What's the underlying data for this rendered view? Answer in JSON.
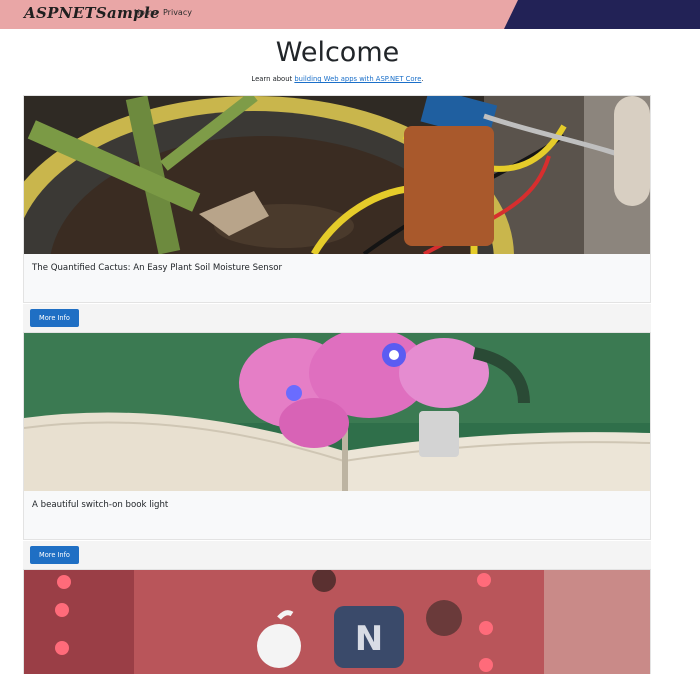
{
  "navbar": {
    "brand": "ASPNETSample",
    "links": [
      {
        "label": "Home"
      },
      {
        "label": "Privacy"
      }
    ]
  },
  "main": {
    "title": "Welcome",
    "lead_prefix": "Learn about ",
    "lead_link": "building Web apps with ASP.NET Core",
    "lead_suffix": "."
  },
  "cards": [
    {
      "title": "The Quantified Cactus: An Easy Plant Soil Moisture Sensor",
      "button": "More Info",
      "image": "cactus-sensor-photo"
    },
    {
      "title": "A beautiful switch-on book light",
      "button": "More Info",
      "image": "flower-book-light-photo"
    },
    {
      "title": "",
      "button": "",
      "image": "led-stickers-photo"
    }
  ],
  "colors": {
    "navbar_bg": "#e9a6a6",
    "navbar_accent": "#222256",
    "button_bg": "#1f6fc4",
    "link": "#1a6fc9"
  }
}
